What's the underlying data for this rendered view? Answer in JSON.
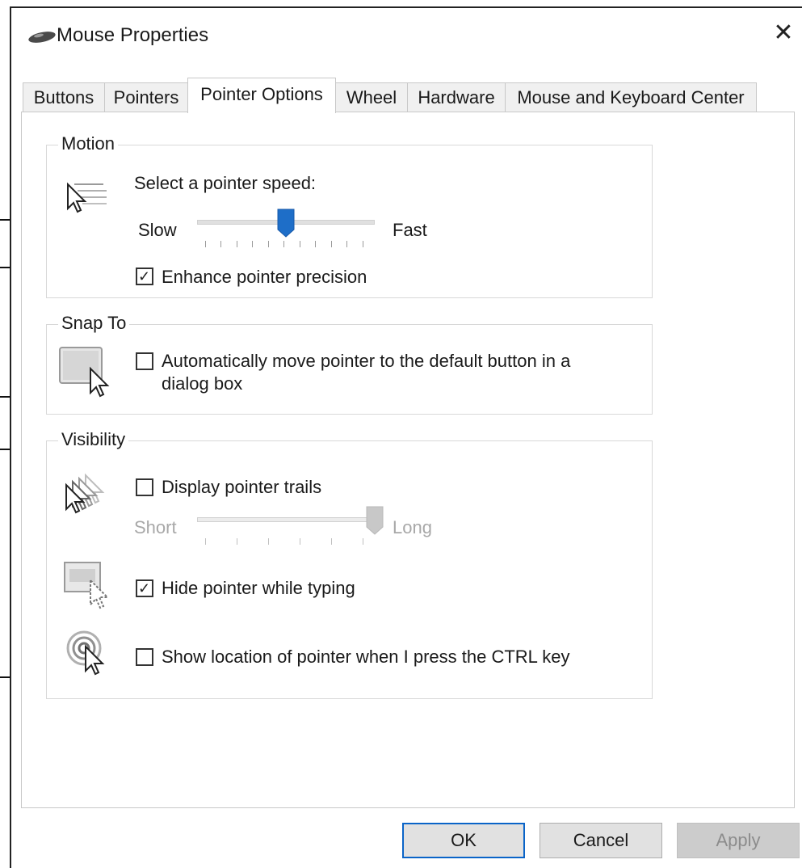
{
  "window": {
    "title": "Mouse Properties",
    "close_glyph": "✕",
    "icon": "mouse-icon"
  },
  "tabs": [
    {
      "label": "Buttons",
      "active": false
    },
    {
      "label": "Pointers",
      "active": false
    },
    {
      "label": "Pointer Options",
      "active": true
    },
    {
      "label": "Wheel",
      "active": false
    },
    {
      "label": "Hardware",
      "active": false
    },
    {
      "label": "Mouse and Keyboard Center",
      "active": false
    }
  ],
  "motion": {
    "group_label": "Motion",
    "speed_label": "Select a pointer speed:",
    "slow_label": "Slow",
    "fast_label": "Fast",
    "speed_level": 0.5,
    "enhance_label": "Enhance pointer precision",
    "enhance_checked": true
  },
  "snap_to": {
    "group_label": "Snap To",
    "auto_move_label_line1": "Automatically move pointer to the default button in a",
    "auto_move_label_line2": "dialog box",
    "auto_move_checked": false
  },
  "visibility": {
    "group_label": "Visibility",
    "trails_label": "Display pointer trails",
    "trails_checked": false,
    "short_label": "Short",
    "long_label": "Long",
    "trail_level": 1.0,
    "hide_label": "Hide pointer while typing",
    "hide_checked": true,
    "show_location_label": "Show location of pointer when I press the CTRL key",
    "show_location_checked": false
  },
  "buttons": {
    "ok": "OK",
    "cancel": "Cancel",
    "apply": "Apply"
  },
  "colors": {
    "accent": "#1e6ec8",
    "disabled_text": "#a8a8a8",
    "callout_lines": "#111111"
  },
  "check_glyph": "✓"
}
